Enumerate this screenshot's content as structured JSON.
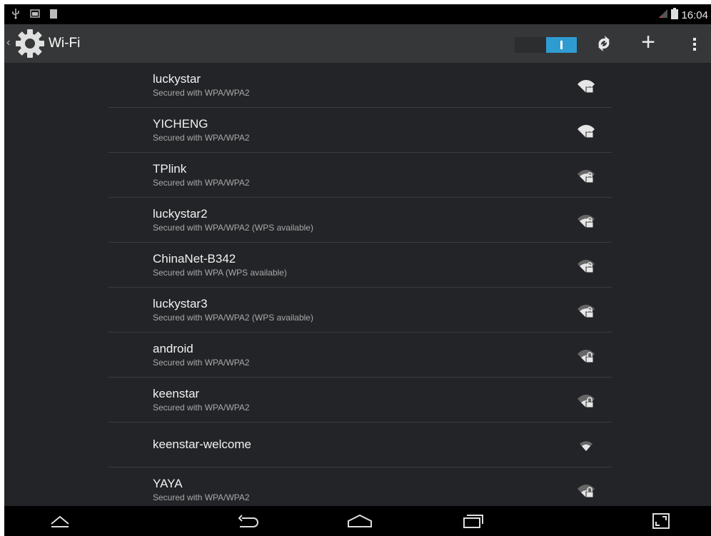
{
  "status_bar": {
    "left_icons": [
      "usb-icon",
      "screenshot-notification-icon",
      "sd-card-icon"
    ],
    "right_icons": [
      "signal-icon",
      "battery-icon"
    ],
    "time": "16:04"
  },
  "action_bar": {
    "title": "Wi-Fi",
    "icon": "settings-gear-icon",
    "toggle_state": "on",
    "actions": [
      "wps-refresh-icon",
      "add-network-icon",
      "overflow-menu-icon"
    ]
  },
  "networks": [
    {
      "ssid": "luckystar",
      "security": "Secured with WPA/WPA2",
      "locked": true
    },
    {
      "ssid": "YICHENG",
      "security": "Secured with WPA/WPA2",
      "locked": true
    },
    {
      "ssid": "TPlink",
      "security": "Secured with WPA/WPA2",
      "locked": true
    },
    {
      "ssid": "luckystar2",
      "security": "Secured with WPA/WPA2 (WPS available)",
      "locked": true
    },
    {
      "ssid": "ChinaNet-B342",
      "security": "Secured with WPA (WPS available)",
      "locked": true
    },
    {
      "ssid": "luckystar3",
      "security": "Secured with WPA/WPA2 (WPS available)",
      "locked": true
    },
    {
      "ssid": "android",
      "security": "Secured with WPA/WPA2",
      "locked": true
    },
    {
      "ssid": "keenstar",
      "security": "Secured with WPA/WPA2",
      "locked": true
    },
    {
      "ssid": "keenstar-welcome",
      "security": "",
      "locked": false
    },
    {
      "ssid": "YAYA",
      "security": "Secured with WPA/WPA2",
      "locked": true
    }
  ],
  "nav_bar": {
    "buttons": [
      "hide-keyboard-icon",
      "back-icon",
      "home-icon",
      "recent-apps-icon",
      "screenshot-icon"
    ]
  },
  "colors": {
    "background": "#232427",
    "action_bar": "#363738",
    "accent": "#2f9cd1"
  }
}
